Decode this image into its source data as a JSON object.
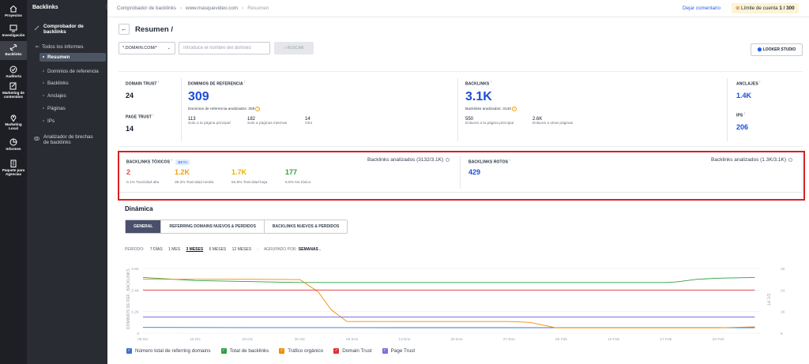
{
  "rail": {
    "items": [
      {
        "label": "Proyectos"
      },
      {
        "label": "Investigación"
      },
      {
        "label": "Backlinks"
      },
      {
        "label": "Auditoría"
      },
      {
        "label": "Marketing de contenidos"
      },
      {
        "label": "Marketing Local"
      },
      {
        "label": "Informes"
      },
      {
        "label": "Paquete para Agencias"
      }
    ]
  },
  "nav": {
    "title": "Backlinks",
    "collapse": "‹",
    "section": "Comprobador de backlinks",
    "items": [
      "Todos los informes",
      "Resumen",
      "Dominios de referencia",
      "Backlinks",
      "Anclajes",
      "Páginas",
      "IPs"
    ],
    "gap_tool": "Analizador de brechas de backlinks"
  },
  "topbar": {
    "crumbs": [
      "Comprobador de backlinks",
      "www.masquevideo.com",
      "Resumen"
    ],
    "feedback": "Dejar comentario",
    "limit_label": "Límite de cuenta",
    "limit_value": "1 / 300"
  },
  "page": {
    "title": "Resumen /",
    "domain_mode": "*.DOMAIN.COM/*",
    "domain_placeholder": "Introduce el nombre del dominio",
    "search_label": "BUSCAR",
    "looker_label": "LOOKER STUDIO"
  },
  "metrics": {
    "domain_trust": {
      "label": "DOMAIN TRUST",
      "value": "24"
    },
    "page_trust": {
      "label": "PAGE TRUST",
      "value": "14"
    },
    "ref_domains": {
      "label": "DOMINIOS DE REFERENCIA",
      "value": "309",
      "analyzed": "Dominios de referencia analizados: 309",
      "subs": [
        {
          "value": "113",
          "label": "Solo a la página principal"
        },
        {
          "value": "182",
          "label": "Solo a páginas internas"
        },
        {
          "value": "14",
          "label": "Otro"
        }
      ]
    },
    "backlinks": {
      "label": "BACKLINKS",
      "value": "3.1K",
      "analyzed": "Backlinks analizados: 3140",
      "subs": [
        {
          "value": "550",
          "label": "Enlaces a la página principal"
        },
        {
          "value": "2.6K",
          "label": "Enlaces a otras páginas"
        }
      ]
    },
    "anchors": {
      "label": "ANCLAJES",
      "value": "1.4K"
    },
    "ips": {
      "label": "IPS",
      "value": "206"
    }
  },
  "toxic": {
    "label": "BACKLINKS TÓXICOS",
    "beta": "BETA",
    "analyzed": "Backlinks analizados (3132/3.1K)",
    "values": [
      {
        "value": "2",
        "label": "0.1% Toxicidad alta",
        "color": "#e5484d"
      },
      {
        "value": "1.2K",
        "label": "39.2% Toxicidad media",
        "color": "#f59e0b"
      },
      {
        "value": "1.7K",
        "label": "54.8% Toxicidad baja",
        "color": "#eab308"
      },
      {
        "value": "177",
        "label": "5.6% No tóxico",
        "color": "#2f9e44"
      }
    ],
    "broken_label": "BACKLINKS ROTOS",
    "broken_value": "429",
    "broken_analyzed": "Backlinks analizados (1.3K/3.1K)"
  },
  "dinamica": {
    "title": "Dinámica",
    "tabs": [
      "GENERAL",
      "REFERRING DOMAINS NUEVOS & PERDIDOS",
      "BACKLINKS NUEVOS & PERDIDOS"
    ],
    "period_label": "PERÍODO:",
    "periods": [
      "7 DÍAS",
      "1 MES",
      "3 MESES",
      "6 MESES",
      "12 MESES"
    ],
    "group_label": "AGRUPADO POR:",
    "group_value": "SEMANAS"
  },
  "chart_data": {
    "type": "line",
    "ylabel": "DOMINIOS DE REF., BACKLINKS",
    "y2label": "DT, PT",
    "x": [
      "09 Dic",
      "16 Dic",
      "23 Dic",
      "30 Dic",
      "06 Ene",
      "13 Ene",
      "20 Ene",
      "27 Ene",
      "03 Feb",
      "10 Feb",
      "17 Feb",
      "24 Feb"
    ],
    "yticks": [
      "0",
      "1.2K",
      "2.4K",
      "3.6K"
    ],
    "y2ticks": [
      "8",
      "16",
      "24",
      "32"
    ],
    "ylim": [
      0,
      3600
    ],
    "y2lim": [
      8,
      32
    ],
    "series": [
      {
        "name": "Número total de referring domains",
        "color": "#3b6fd4",
        "axis": "left",
        "x": [
          0,
          1,
          2,
          3,
          4,
          5,
          6,
          7,
          8,
          9,
          10,
          11,
          11.7
        ],
        "values": [
          320,
          315,
          312,
          310,
          310,
          308,
          308,
          309,
          309,
          309,
          309,
          309,
          309
        ]
      },
      {
        "name": "Total de backlinks",
        "color": "#2f9e44",
        "axis": "left",
        "x": [
          0,
          1,
          2,
          3,
          4,
          5,
          6,
          7,
          8,
          9,
          10,
          10.2,
          10.6,
          11,
          11.7
        ],
        "values": [
          3100,
          2930,
          2870,
          2820,
          2820,
          2820,
          2820,
          2820,
          2820,
          2820,
          2820,
          2850,
          3000,
          3060,
          3100
        ]
      },
      {
        "name": "Tráfico orgánico",
        "color": "#f08c00",
        "axis": "left",
        "x": [
          0,
          1,
          2,
          3,
          3.35,
          3.6,
          3.9,
          4,
          5,
          6,
          7,
          7.4,
          7.9,
          8,
          9,
          10,
          11,
          11.7
        ],
        "values": [
          3000,
          3000,
          3000,
          2980,
          2300,
          1300,
          650,
          650,
          650,
          650,
          650,
          600,
          300,
          300,
          300,
          300,
          300,
          350
        ]
      },
      {
        "name": "Domain Trust",
        "color": "#e03131",
        "axis": "right",
        "x": [
          0,
          1,
          2,
          3,
          4,
          5,
          6,
          7,
          8,
          9,
          10,
          11,
          11.7
        ],
        "values": [
          24,
          24,
          24,
          24,
          24,
          24,
          24,
          24,
          24,
          24,
          24,
          24,
          24
        ]
      },
      {
        "name": "Page Trust",
        "color": "#7c6fe0",
        "axis": "right",
        "x": [
          0,
          1,
          2,
          3,
          4,
          5,
          6,
          7,
          8,
          9,
          10,
          11,
          11.7
        ],
        "values": [
          14,
          14,
          14,
          14,
          14,
          14,
          14,
          14,
          14,
          14,
          14,
          14,
          14
        ]
      }
    ]
  }
}
